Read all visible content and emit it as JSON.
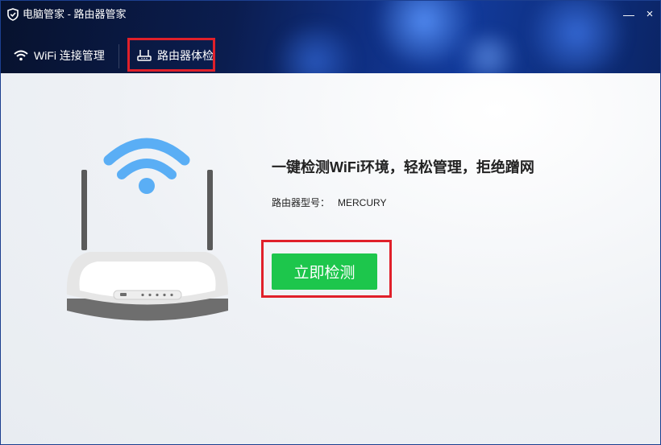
{
  "window": {
    "title": "电脑管家 - 路由器管家",
    "minimize_label": "—",
    "close_label": "×"
  },
  "tabs": [
    {
      "label": "WiFi 连接管理",
      "icon": "wifi-icon",
      "active": false
    },
    {
      "label": "路由器体检",
      "icon": "router-icon",
      "active": true
    }
  ],
  "main": {
    "headline": "一键检测WiFi环境，轻松管理，拒绝蹭网",
    "model_label": "路由器型号：",
    "model_value": "MERCURY",
    "check_button_label": "立即检测"
  },
  "colors": {
    "accent_green": "#1dc64c",
    "highlight_red": "#e0202a",
    "wifi_blue": "#5aaef5",
    "header_blue": "#0f2f82"
  }
}
